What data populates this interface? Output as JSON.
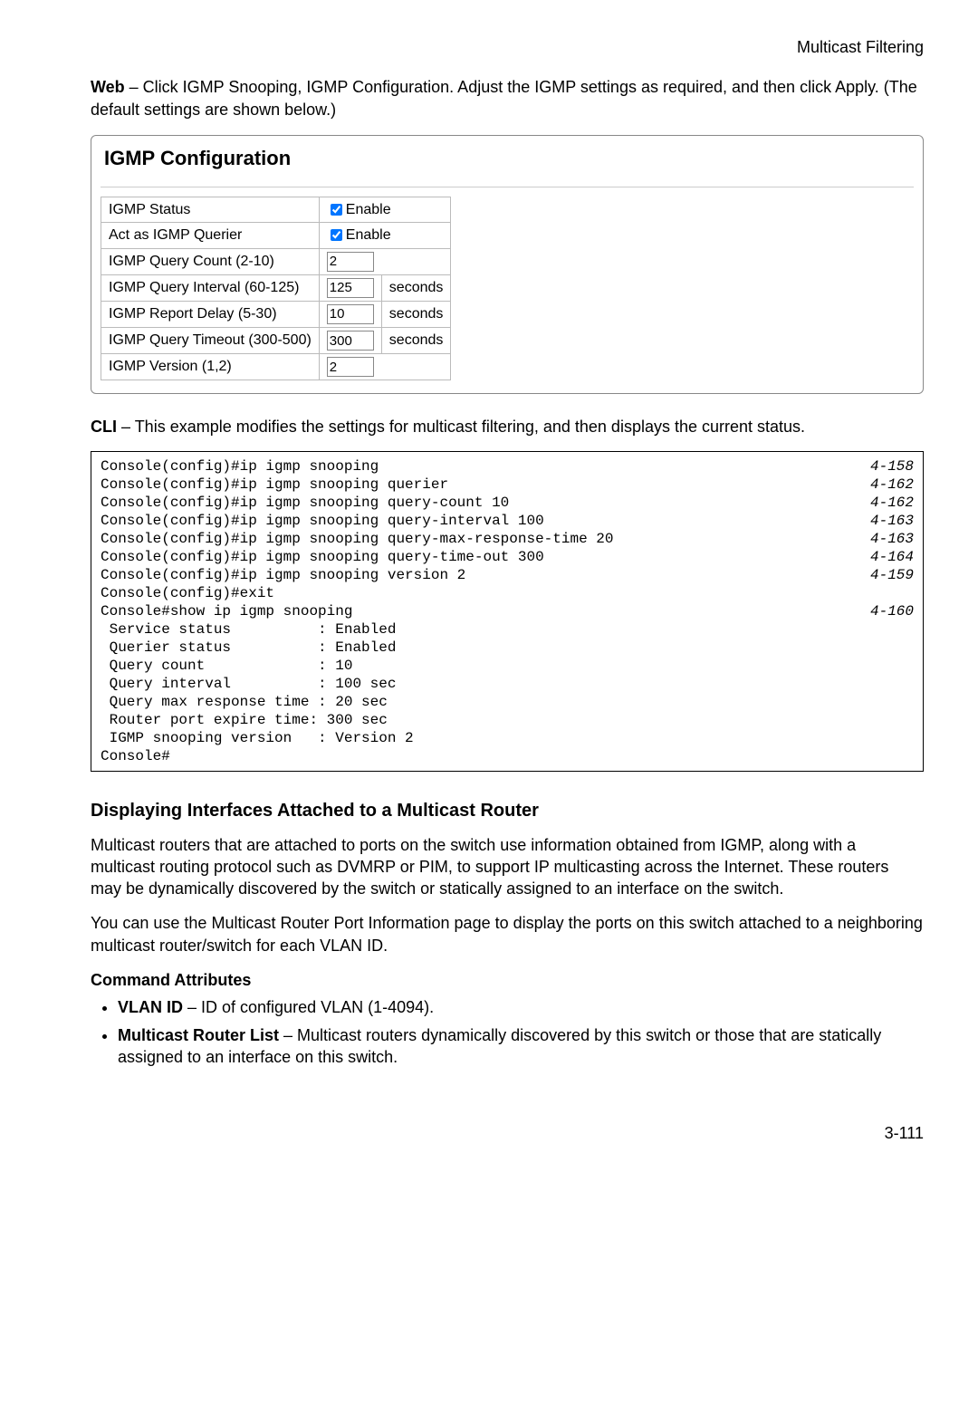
{
  "header": {
    "title": "Multicast Filtering"
  },
  "web_para": {
    "lead": "Web",
    "text": " – Click IGMP Snooping, IGMP Configuration. Adjust the IGMP settings as required, and then click Apply. (The default settings are shown below.)"
  },
  "config": {
    "title": "IGMP Configuration",
    "rows": [
      {
        "label": "IGMP Status",
        "type": "checkbox",
        "cb_label": "Enable",
        "checked": true
      },
      {
        "label": "Act as IGMP Querier",
        "type": "checkbox",
        "cb_label": "Enable",
        "checked": true
      },
      {
        "label": "IGMP Query Count (2-10)",
        "type": "text",
        "value": "2",
        "suffix": ""
      },
      {
        "label": "IGMP Query Interval (60-125)",
        "type": "text",
        "value": "125",
        "suffix": "seconds"
      },
      {
        "label": "IGMP Report Delay (5-30)",
        "type": "text",
        "value": "10",
        "suffix": "seconds"
      },
      {
        "label": "IGMP Query Timeout (300-500)",
        "type": "text",
        "value": "300",
        "suffix": "seconds"
      },
      {
        "label": "IGMP Version (1,2)",
        "type": "text",
        "value": "2",
        "suffix": ""
      }
    ]
  },
  "cli_para": {
    "lead": "CLI",
    "text": " – This example modifies the settings for multicast filtering, and then displays the current status."
  },
  "console": {
    "lines": [
      {
        "cmd": "Console(config)#ip igmp snooping",
        "ref": "4-158"
      },
      {
        "cmd": "Console(config)#ip igmp snooping querier",
        "ref": "4-162"
      },
      {
        "cmd": "Console(config)#ip igmp snooping query-count 10",
        "ref": "4-162"
      },
      {
        "cmd": "Console(config)#ip igmp snooping query-interval 100",
        "ref": "4-163"
      },
      {
        "cmd": "Console(config)#ip igmp snooping query-max-response-time 20",
        "ref": "4-163"
      },
      {
        "cmd": "Console(config)#ip igmp snooping query-time-out 300",
        "ref": "4-164"
      },
      {
        "cmd": "Console(config)#ip igmp snooping version 2",
        "ref": "4-159"
      },
      {
        "cmd": "Console(config)#exit",
        "ref": ""
      },
      {
        "cmd": "Console#show ip igmp snooping",
        "ref": "4-160"
      },
      {
        "cmd": " Service status          : Enabled",
        "ref": ""
      },
      {
        "cmd": " Querier status          : Enabled",
        "ref": ""
      },
      {
        "cmd": " Query count             : 10",
        "ref": ""
      },
      {
        "cmd": " Query interval          : 100 sec",
        "ref": ""
      },
      {
        "cmd": " Query max response time : 20 sec",
        "ref": ""
      },
      {
        "cmd": " Router port expire time: 300 sec",
        "ref": ""
      },
      {
        "cmd": " IGMP snooping version   : Version 2",
        "ref": ""
      },
      {
        "cmd": "Console#",
        "ref": ""
      }
    ]
  },
  "section": {
    "heading": "Displaying Interfaces Attached to a Multicast Router",
    "p1": "Multicast routers that are attached to ports on the switch use information obtained from IGMP, along with a multicast routing protocol such as DVMRP or PIM, to support IP multicasting across the Internet. These routers may be dynamically discovered by the switch or statically assigned to an interface on the switch.",
    "p2": "You can use the Multicast Router Port Information page to display the ports on this switch attached to a neighboring multicast router/switch for each VLAN ID.",
    "sub": "Command Attributes",
    "attrs": [
      {
        "term": "VLAN ID",
        "desc": " – ID of configured VLAN (1-4094)."
      },
      {
        "term": "Multicast Router List",
        "desc": " – Multicast routers dynamically discovered by this switch or those that are statically assigned to an interface on this switch."
      }
    ]
  },
  "page_number": "3-111"
}
